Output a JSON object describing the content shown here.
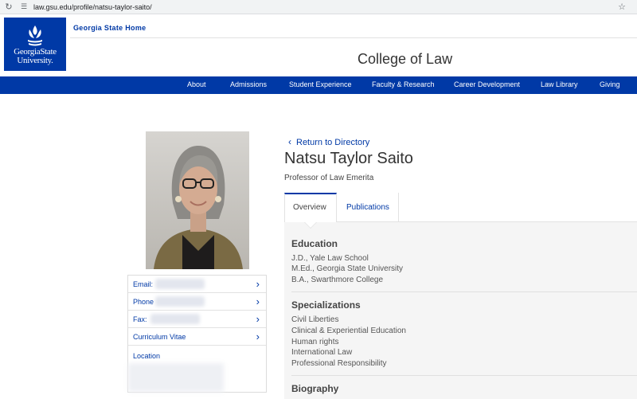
{
  "browser": {
    "url": "law.gsu.edu/profile/natsu-taylor-saito/",
    "reload_icon": "reload-icon",
    "site_info_icon": "site-info-icon",
    "bookmark_icon": "star-icon"
  },
  "header": {
    "logo_line1": "GeorgiaState",
    "logo_line2": "University.",
    "home_link": "Georgia State Home",
    "college_title": "College of Law"
  },
  "nav": {
    "items": [
      "About",
      "Admissions",
      "Student Experience",
      "Faculty & Research",
      "Career Development",
      "Law Library",
      "Giving"
    ]
  },
  "contact": {
    "email_label": "Email:",
    "phone_label": "Phone",
    "fax_label": "Fax:",
    "cv_label": "Curriculum Vitae",
    "location_label": "Location"
  },
  "profile": {
    "return_label": "Return to Directory",
    "name": "Natsu Taylor Saito",
    "title": "Professor of Law Emerita"
  },
  "tabs": {
    "overview": "Overview",
    "publications": "Publications"
  },
  "overview": {
    "education_heading": "Education",
    "education": [
      "J.D., Yale Law School",
      "M.Ed., Georgia State University",
      "B.A., Swarthmore College"
    ],
    "specializations_heading": "Specializations",
    "specializations": [
      "Civil Liberties",
      "Clinical & Experiential Education",
      "Human rights",
      "International Law",
      "Professional Responsibility"
    ],
    "biography_heading": "Biography"
  },
  "colors": {
    "brand_blue": "#0039a6",
    "panel_bg": "#f5f5f5"
  }
}
